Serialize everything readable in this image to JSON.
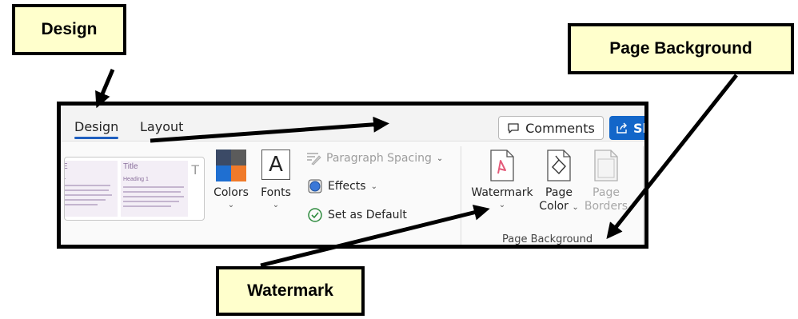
{
  "callouts": {
    "design": "Design",
    "page_background": "Page Background",
    "watermark": "Watermark"
  },
  "tabs": [
    {
      "label": "Design",
      "active": true
    },
    {
      "label": "Layout",
      "active": false
    }
  ],
  "header_buttons": {
    "comments": "Comments",
    "share": "Sh"
  },
  "themes_gallery": {
    "themes": [
      {
        "title": "E",
        "subtitle": "1"
      },
      {
        "title": "Title",
        "subtitle": "Heading 1"
      }
    ],
    "next_glyph": "T"
  },
  "document_formatting": {
    "colors": {
      "label": "Colors"
    },
    "fonts": {
      "label": "Fonts",
      "glyph": "A"
    },
    "paragraph_spacing": {
      "label": "Paragraph Spacing",
      "enabled": false
    },
    "effects": {
      "label": "Effects"
    },
    "set_as_default": {
      "label": "Set as Default"
    }
  },
  "page_background_group": {
    "watermark": {
      "label": "Watermark"
    },
    "page_color": {
      "label_line1": "Page",
      "label_line2": "Color"
    },
    "page_borders": {
      "label_line1": "Page",
      "label_line2": "Borders",
      "enabled": false
    },
    "group_label": "Page Background"
  },
  "icons": {
    "comments": "comment-icon",
    "share": "share-icon",
    "colors": "color-palette-icon",
    "fonts": "font-icon",
    "paragraph_spacing": "paragraph-spacing-icon",
    "effects": "effects-icon",
    "set_as_default": "checkmark-circle-icon",
    "watermark": "watermark-icon",
    "page_color": "paint-bucket-icon",
    "page_borders": "page-borders-icon"
  },
  "colors": {
    "callout_fill": "#ffffcc",
    "accent_blue": "#1366c9",
    "palette": [
      "#3b4a66",
      "#5b5b5b",
      "#1f6fd1",
      "#f07a2a"
    ]
  }
}
